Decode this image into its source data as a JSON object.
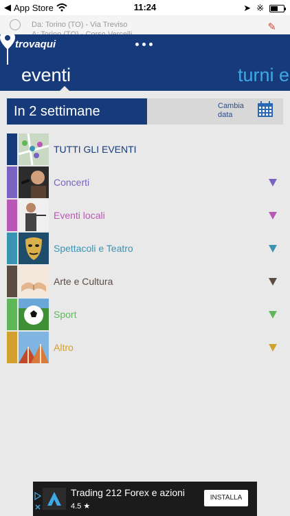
{
  "status_bar": {
    "back_app": "App Store",
    "time": "11:24"
  },
  "route": {
    "from": "Da:  Torino (TO) - Via Treviso",
    "to": "A:  Torino (TO) - Corso Vercelli"
  },
  "header": {
    "brand": "trovaqui",
    "tabs": [
      {
        "label": "eventi",
        "active": true
      },
      {
        "label": "turni e"
      }
    ]
  },
  "period": {
    "label": "In 2 settimane",
    "change_label_line1": "Cambia",
    "change_label_line2": "data"
  },
  "categories": [
    {
      "label": "TUTTI GLI EVENTI",
      "color": "#173b7a",
      "icon": "map-pins-thumbnail",
      "has_expand": false
    },
    {
      "label": "Concerti",
      "color": "#7a63c0",
      "icon": "singer-thumbnail",
      "has_expand": true
    },
    {
      "label": "Eventi locali",
      "color": "#b957b6",
      "icon": "speaker-thumbnail",
      "has_expand": true
    },
    {
      "label": "Spettacoli e Teatro",
      "color": "#3a93b1",
      "icon": "theatre-mask-thumbnail",
      "has_expand": true
    },
    {
      "label": "Arte e Cultura",
      "color": "#5a4b43",
      "icon": "open-book-thumbnail",
      "has_expand": true
    },
    {
      "label": "Sport",
      "color": "#5fb75a",
      "icon": "football-thumbnail",
      "has_expand": true
    },
    {
      "label": "Altro",
      "color": "#d1a02d",
      "icon": "circus-tents-thumbnail",
      "has_expand": true
    }
  ],
  "ad": {
    "title": "Trading 212 Forex e azioni",
    "rating": "4.5 ★",
    "install_label": "INSTALLA"
  }
}
